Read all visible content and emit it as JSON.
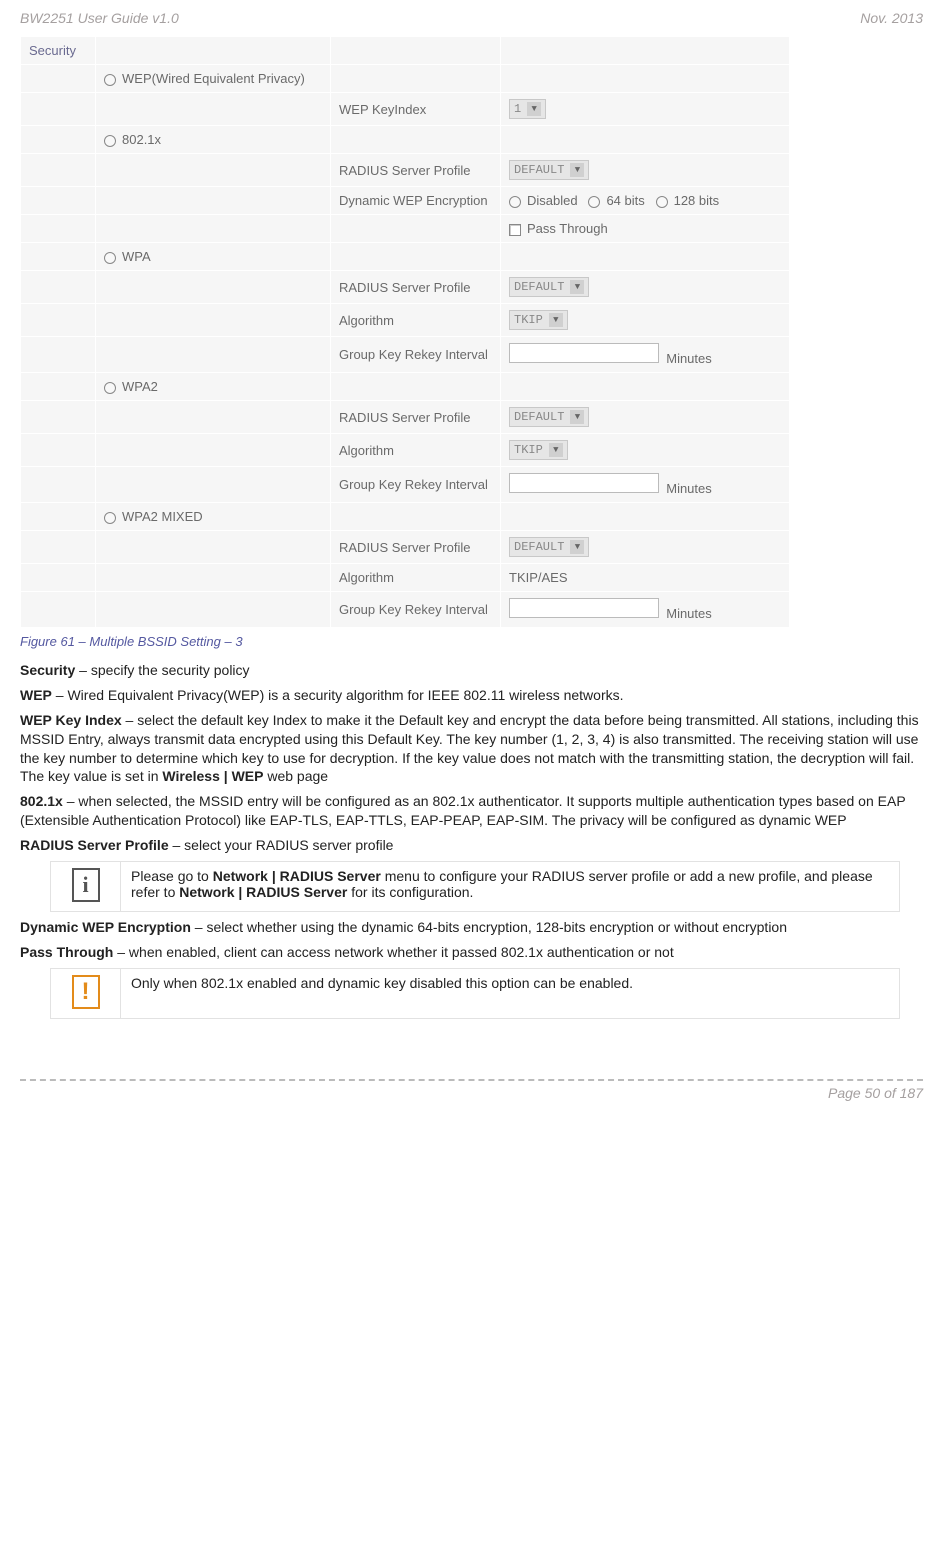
{
  "header": {
    "left": "BW2251 User Guide v1.0",
    "right": "Nov.  2013"
  },
  "table": {
    "securityLabel": "Security",
    "options": {
      "wep": "WEP(Wired Equivalent Privacy)",
      "wepKeyIndex": "WEP KeyIndex",
      "wepKeyValue": "1",
      "x8021": "802.1x",
      "radiusProfile": "RADIUS Server Profile",
      "default": "DEFAULT",
      "dynWep": "Dynamic WEP Encryption",
      "disabled": "Disabled",
      "b64": "64 bits",
      "b128": "128 bits",
      "passThrough": "Pass Through",
      "wpa": "WPA",
      "algorithm": "Algorithm",
      "tkip": "TKIP",
      "groupKey": "Group Key Rekey Interval",
      "minutes": "Minutes",
      "wpa2": "WPA2",
      "wpa2mixed": "WPA2 MIXED",
      "tkipaes": "TKIP/AES"
    }
  },
  "caption": "Figure 61 – Multiple BSSID Setting – 3",
  "body": {
    "securityIntro": {
      "b": "Security",
      "t": " – specify the security policy"
    },
    "wep": {
      "b": "WEP",
      "t": " – Wired Equivalent Privacy(WEP) is a security algorithm for IEEE 802.11 wireless networks."
    },
    "wepKeyIndex": {
      "b": "WEP Key Index",
      "t1": " – select the default key Index to make it the Default key and encrypt the data before being transmitted. All stations, including this MSSID Entry, always transmit data encrypted using this Default Key. The key number (1, 2, 3, 4) is also transmitted. The receiving station will use the key number to determine which key to use for decryption. If the key value does not match with the transmitting station, the decryption will fail. The key value is set in ",
      "b2": "Wireless | WEP",
      "t2": " web page"
    },
    "x8021": {
      "b": "802.1x",
      "t": " – when selected, the MSSID entry will be configured as an 802.1x authenticator. It supports multiple authentication types based on EAP (Extensible Authentication Protocol) like EAP-TLS, EAP-TTLS, EAP-PEAP, EAP-SIM. The privacy will be configured as dynamic WEP"
    },
    "radius": {
      "b": "RADIUS Server Profile",
      "t": " – select your RADIUS server profile"
    },
    "note1": {
      "p1": "Please go to ",
      "b1": "Network | RADIUS Server",
      "p2": " menu to configure your RADIUS server profile or add a new profile, and please refer to ",
      "b2": "Network | RADIUS Server",
      "p3": " for its configuration."
    },
    "dynwep": {
      "b": "Dynamic WEP Encryption",
      "t": " – select whether using the dynamic 64-bits encryption, 128-bits encryption or without encryption"
    },
    "passThrough": {
      "b": "Pass Through",
      "t": " – when enabled, client can access network whether it passed 802.1x authentication or not"
    },
    "note2": "Only when 802.1x enabled and dynamic key disabled this option can be enabled."
  },
  "footer": "Page 50 of 187"
}
